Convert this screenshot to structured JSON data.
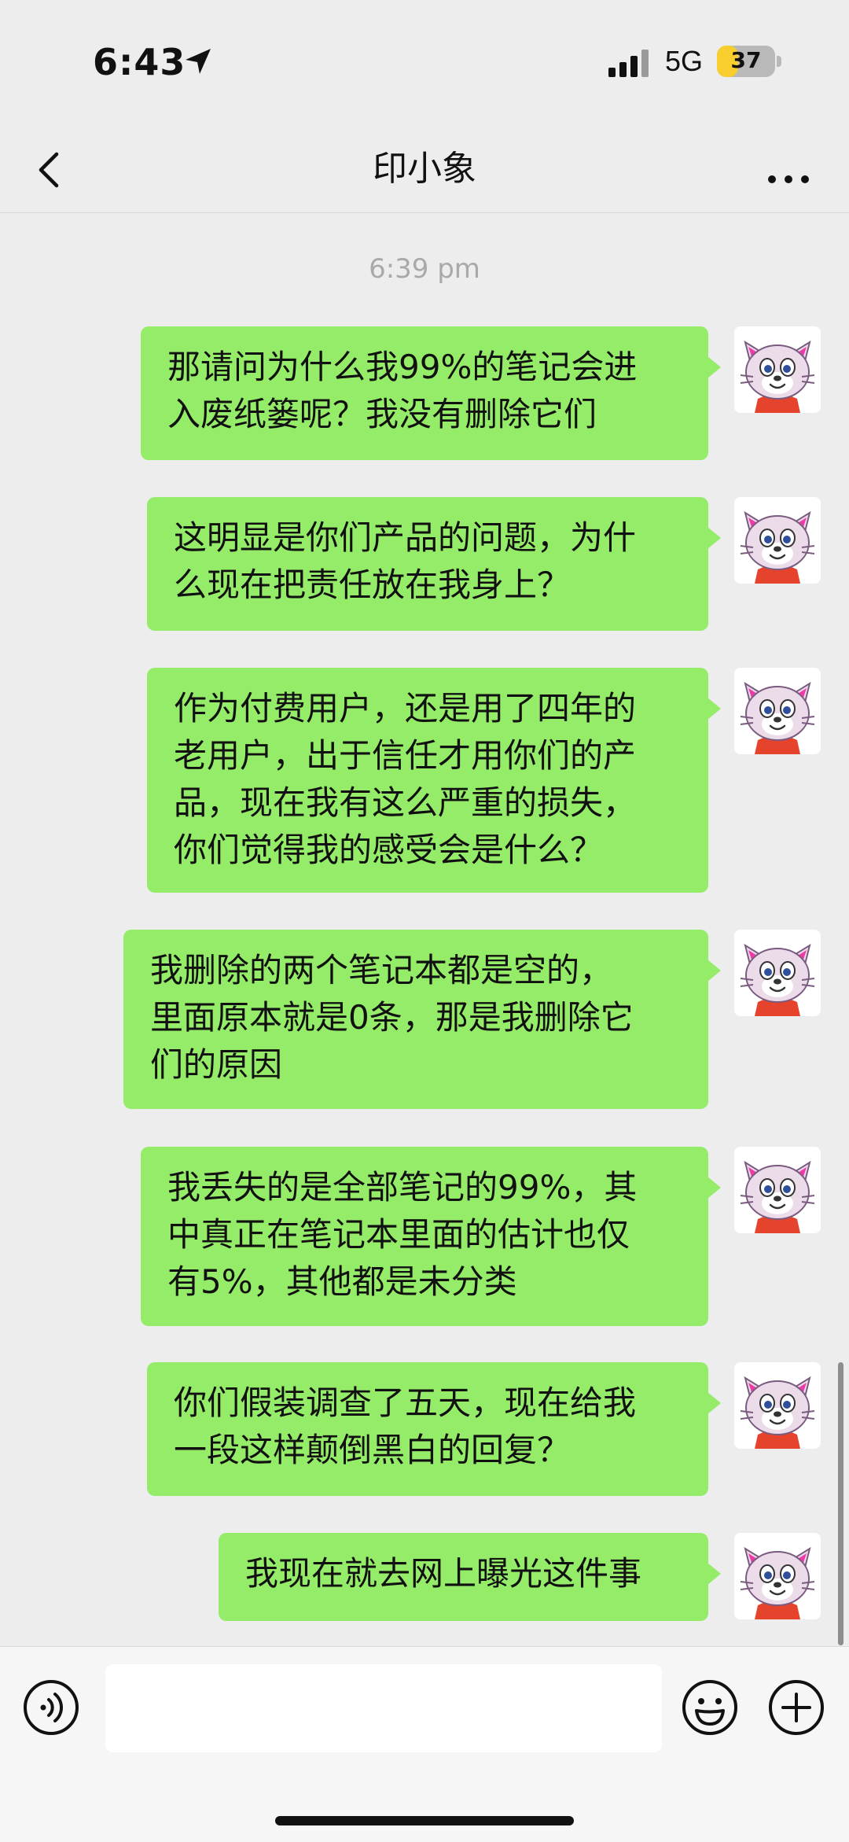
{
  "status_bar": {
    "time": "6:43",
    "network": "5G",
    "battery_level": "37",
    "battery_fraction": 0.37,
    "battery_color": "#f7ce2e",
    "icons": [
      "location-arrow-icon",
      "signal-bars-icon"
    ]
  },
  "nav": {
    "title": "印小象",
    "back_icon": "chevron-left-icon",
    "more_icon": "ellipsis-icon"
  },
  "chat": {
    "timestamp": "6:39 pm",
    "bubble_color": "#95ec69",
    "background_color": "#ededed",
    "messages": [
      {
        "lines": [
          "那请问为什么我99%的笔记会进",
          "入废纸篓呢？我没有删除它们"
        ]
      },
      {
        "lines": [
          "这明显是你们产品的问题，为什",
          "么现在把责任放在我身上？"
        ]
      },
      {
        "lines": [
          "作为付费用户，还是用了四年的",
          "老用户，出于信任才用你们的产",
          "品，现在我有这么严重的损失，",
          "你们觉得我的感受会是什么？"
        ]
      },
      {
        "lines": [
          "我删除的两个笔记本都是空的，",
          "里面原本就是0条，那是我删除它",
          "们的原因"
        ]
      },
      {
        "lines": [
          "我丢失的是全部笔记的99%，其",
          "中真正在笔记本里面的估计也仅",
          "有5%，其他都是未分类"
        ]
      },
      {
        "lines": [
          "你们假装调查了五天，现在给我",
          "一段这样颠倒黑白的回复？"
        ]
      },
      {
        "lines": [
          "我现在就去网上曝光这件事"
        ]
      }
    ]
  },
  "input_bar": {
    "placeholder": "",
    "icons": [
      "voice-icon",
      "emoji-icon",
      "plus-icon"
    ]
  }
}
